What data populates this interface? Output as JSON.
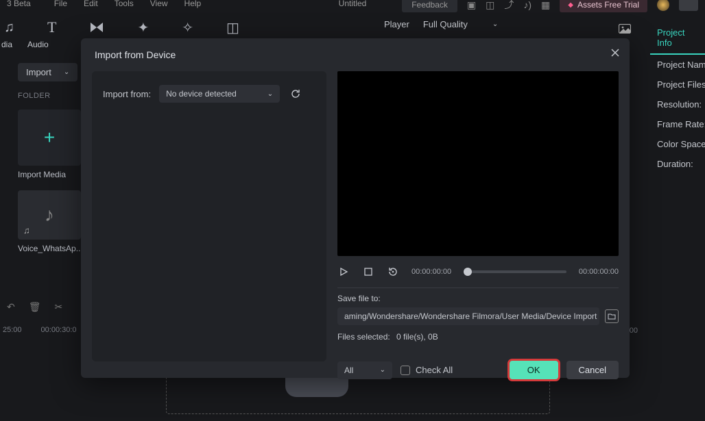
{
  "top": {
    "app_name": "3 Beta",
    "menu": {
      "file": "File",
      "edit": "Edit",
      "tools": "Tools",
      "view": "View",
      "help": "Help"
    },
    "doc_title": "Untitled",
    "feedback": "Feedback",
    "assets": "Assets Free Trial"
  },
  "toolbar": {
    "media_label": "dia",
    "audio_label": "Audio",
    "text_label": "T"
  },
  "player": {
    "label": "Player",
    "quality": "Full Quality"
  },
  "project_info": {
    "tab": "Project Info",
    "name": "Project Name",
    "files": "Project Files",
    "resolution": "Resolution:",
    "framerate": "Frame Rate:",
    "colorspace": "Color Space:",
    "duration": "Duration:"
  },
  "left": {
    "import": "Import",
    "folder": "FOLDER",
    "import_media": "Import Media",
    "audio_item": "Voice_WhatsAp..."
  },
  "timeline": {
    "t1": "25:00",
    "t2": "00:00:30:0",
    "end": "00"
  },
  "modal": {
    "title": "Import from Device",
    "import_from": "Import from:",
    "no_device": "No device detected",
    "time_start": "00:00:00:00",
    "time_end": "00:00:00:00",
    "save_to": "Save file to:",
    "save_path": "aming/Wondershare/Wondershare Filmora/User Media/Device Import",
    "files_selected_label": "Files selected:",
    "files_selected_value": "0 file(s), 0B",
    "filter": "All",
    "check_all": "Check All",
    "ok": "OK",
    "cancel": "Cancel"
  }
}
